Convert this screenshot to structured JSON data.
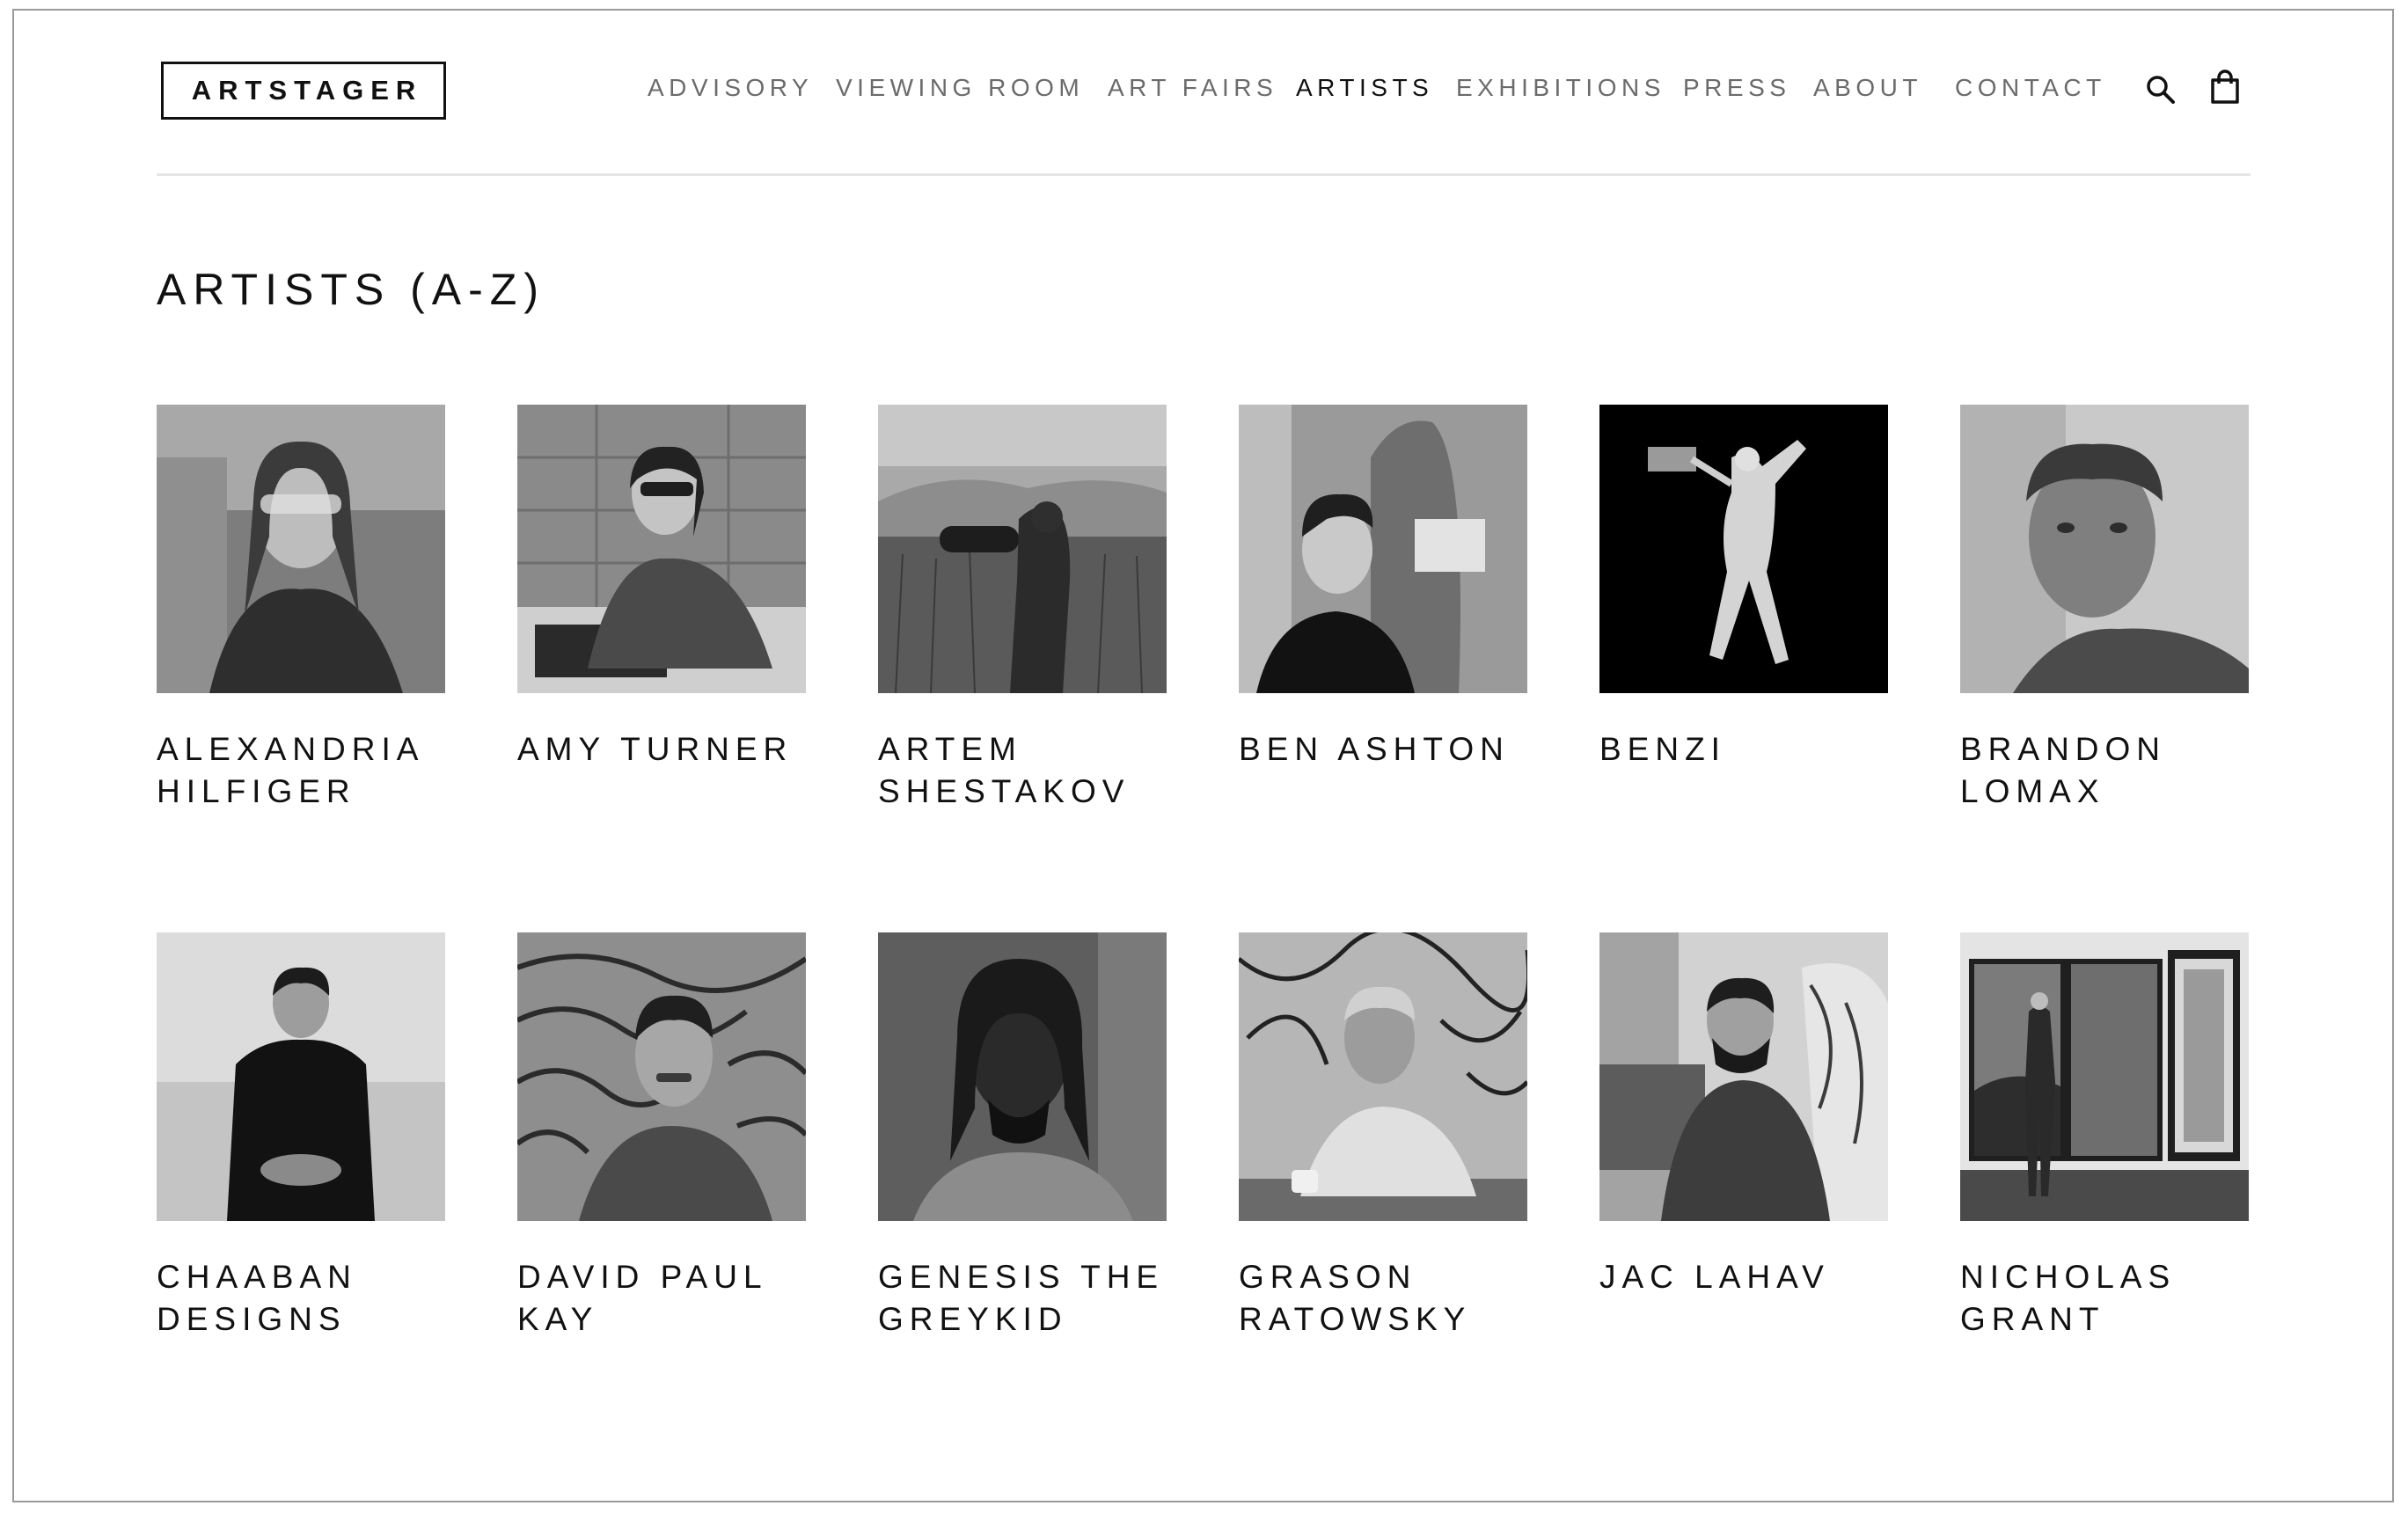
{
  "brand": {
    "logo_text": "ARTSTAGER"
  },
  "nav": {
    "items": [
      {
        "label": "ADVISORY",
        "active": false
      },
      {
        "label": "VIEWING ROOM",
        "active": false
      },
      {
        "label": "ART FAIRS",
        "active": false
      },
      {
        "label": "ARTISTS",
        "active": true
      },
      {
        "label": "EXHIBITIONS",
        "active": false
      },
      {
        "label": "PRESS",
        "active": false
      },
      {
        "label": "ABOUT",
        "active": false
      },
      {
        "label": "CONTACT",
        "active": false
      }
    ],
    "icons": [
      "search-icon",
      "shopping-bag-icon"
    ]
  },
  "page": {
    "title": "ARTISTS (A-Z)"
  },
  "artists": [
    {
      "name": "ALEXANDRIA HILFIGER"
    },
    {
      "name": "AMY TURNER"
    },
    {
      "name": "ARTEM SHESTAKOV"
    },
    {
      "name": "BEN ASHTON"
    },
    {
      "name": "BENZI"
    },
    {
      "name": "BRANDON LOMAX"
    },
    {
      "name": "CHAABAN DESIGNS"
    },
    {
      "name": "DAVID PAUL KAY"
    },
    {
      "name": "GENESIS THE GREYKID"
    },
    {
      "name": "GRASON RATOWSKY"
    },
    {
      "name": "JAC LAHAV"
    },
    {
      "name": "NICHOLAS GRANT"
    }
  ],
  "colors": {
    "text": "#111111",
    "nav_inactive": "#6b6b6b",
    "divider": "#e6e6e6"
  }
}
